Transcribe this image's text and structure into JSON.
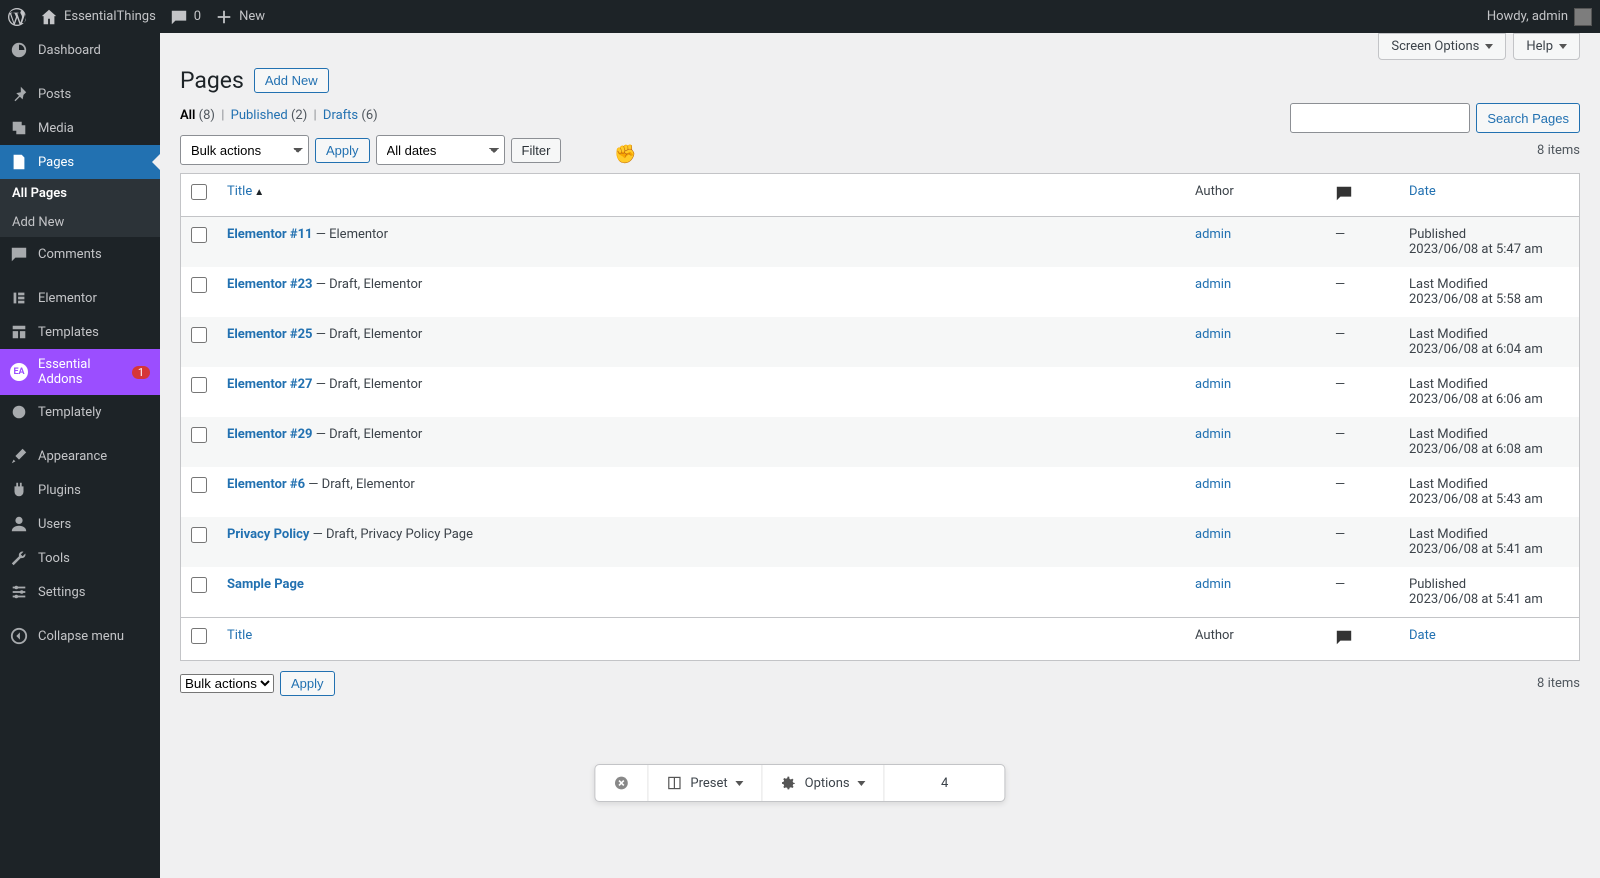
{
  "adminbar": {
    "site_name": "EssentialThings",
    "comments": "0",
    "new": "New",
    "howdy": "Howdy, admin"
  },
  "sidebar": {
    "items": [
      {
        "label": "Dashboard"
      },
      {
        "label": "Posts"
      },
      {
        "label": "Media"
      },
      {
        "label": "Pages"
      },
      {
        "label": "Comments"
      },
      {
        "label": "Elementor"
      },
      {
        "label": "Templates"
      },
      {
        "label": "Essential Addons",
        "badge": "1"
      },
      {
        "label": "Templately"
      },
      {
        "label": "Appearance"
      },
      {
        "label": "Plugins"
      },
      {
        "label": "Users"
      },
      {
        "label": "Tools"
      },
      {
        "label": "Settings"
      },
      {
        "label": "Collapse menu"
      }
    ],
    "submenu_pages": {
      "all_pages": "All Pages",
      "add_new": "Add New"
    },
    "ea_initials": "EA"
  },
  "topright": {
    "screen_options": "Screen Options",
    "help": "Help"
  },
  "header": {
    "title": "Pages",
    "add_new": "Add New"
  },
  "filters": {
    "all": "All",
    "all_count": "(8)",
    "published": "Published",
    "published_count": "(2)",
    "drafts": "Drafts",
    "drafts_count": "(6)"
  },
  "nav": {
    "bulk_actions": "Bulk actions",
    "apply": "Apply",
    "all_dates": "All dates",
    "filter": "Filter",
    "items_count": "8 items"
  },
  "search": {
    "button": "Search Pages"
  },
  "columns": {
    "title": "Title",
    "author": "Author",
    "date": "Date"
  },
  "rows": [
    {
      "title": "Elementor #11",
      "suffix": " — Elementor",
      "author": "admin",
      "comments": "—",
      "date1": "Published",
      "date2": "2023/06/08 at 5:47 am"
    },
    {
      "title": "Elementor #23",
      "suffix": " — Draft, Elementor",
      "author": "admin",
      "comments": "—",
      "date1": "Last Modified",
      "date2": "2023/06/08 at 5:58 am"
    },
    {
      "title": "Elementor #25",
      "suffix": " — Draft, Elementor",
      "author": "admin",
      "comments": "—",
      "date1": "Last Modified",
      "date2": "2023/06/08 at 6:04 am"
    },
    {
      "title": "Elementor #27",
      "suffix": " — Draft, Elementor",
      "author": "admin",
      "comments": "—",
      "date1": "Last Modified",
      "date2": "2023/06/08 at 6:06 am"
    },
    {
      "title": "Elementor #29",
      "suffix": " — Draft, Elementor",
      "author": "admin",
      "comments": "—",
      "date1": "Last Modified",
      "date2": "2023/06/08 at 6:08 am"
    },
    {
      "title": "Elementor #6",
      "suffix": " — Draft, Elementor",
      "author": "admin",
      "comments": "—",
      "date1": "Last Modified",
      "date2": "2023/06/08 at 5:43 am"
    },
    {
      "title": "Privacy Policy",
      "suffix": " — Draft, Privacy Policy Page",
      "author": "admin",
      "comments": "—",
      "date1": "Last Modified",
      "date2": "2023/06/08 at 5:41 am"
    },
    {
      "title": "Sample Page",
      "suffix": "",
      "author": "admin",
      "comments": "—",
      "date1": "Published",
      "date2": "2023/06/08 at 5:41 am"
    }
  ],
  "floatbar": {
    "preset": "Preset",
    "options": "Options",
    "value": "4"
  }
}
